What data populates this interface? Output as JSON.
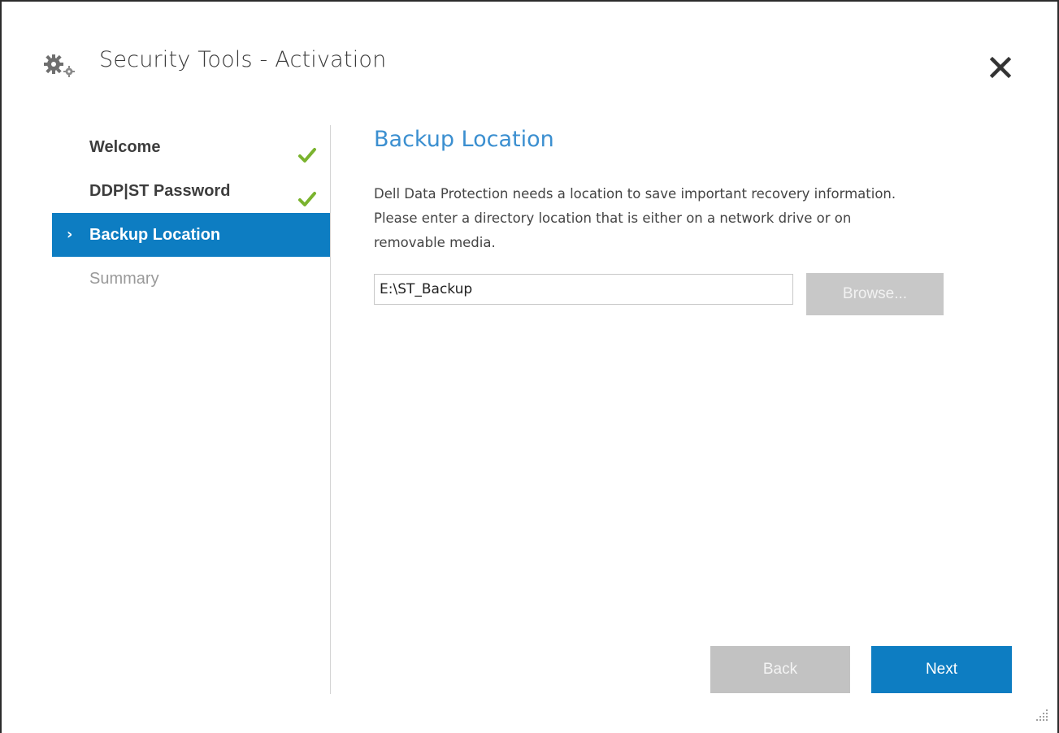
{
  "window": {
    "title": "Security Tools - Activation",
    "icon": "gears-icon",
    "close_icon": "close-icon"
  },
  "nav": {
    "items": [
      {
        "label": "Welcome",
        "state": "completed",
        "icon": "check-icon"
      },
      {
        "label": "DDP|ST Password",
        "state": "completed",
        "icon": "check-icon"
      },
      {
        "label": "Backup Location",
        "state": "active",
        "icon": "chevron-right-icon"
      },
      {
        "label": "Summary",
        "state": "disabled"
      }
    ]
  },
  "main": {
    "heading": "Backup Location",
    "description_lines": [
      "Dell Data Protection needs a location to save important recovery information.",
      "Please enter a directory location that is either on a network drive or on",
      "removable media."
    ],
    "path_value": "E:\\ST_Backup",
    "browse_label": "Browse..."
  },
  "footer": {
    "back_label": "Back",
    "next_label": "Next"
  },
  "colors": {
    "accent": "#0d7dc2",
    "heading": "#3b8fd0",
    "check": "#7ab32e",
    "disabled_button": "#c2c2c2"
  }
}
